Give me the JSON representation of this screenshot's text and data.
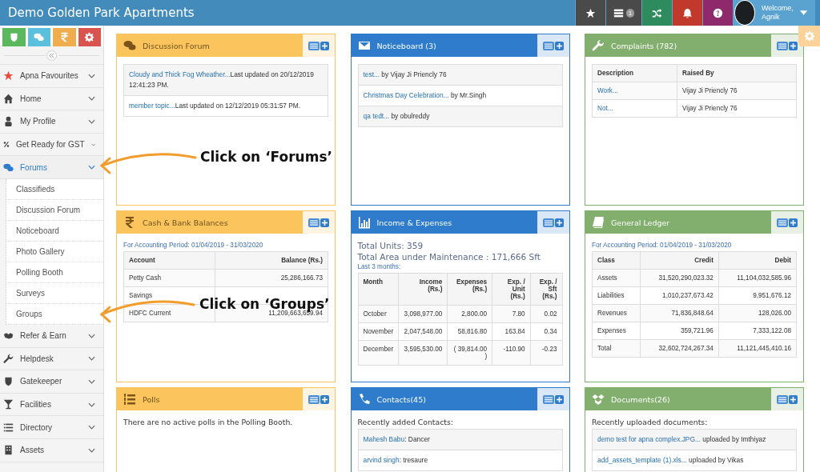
{
  "header": {
    "title": "Demo Golden Park Apartments",
    "buttons": [
      {
        "color": "#4a4a4a"
      },
      {
        "color": "#4a4a4a",
        "badge": "1"
      },
      {
        "color": "#2e8b5e"
      },
      {
        "color": "#c0392b"
      },
      {
        "color": "#8e2a6b"
      }
    ],
    "user": {
      "greeting": "Welcome,",
      "name": "Agnik"
    }
  },
  "sidebar": {
    "shortcuts": [
      {
        "color": "#5cb85c"
      },
      {
        "color": "#5bc0de"
      },
      {
        "color": "#f0ad4e"
      },
      {
        "color": "#d9534f"
      }
    ],
    "items": [
      {
        "label": "Apna Favourites",
        "selected": false
      },
      {
        "label": "Home",
        "selected": false
      },
      {
        "label": "My Profile",
        "selected": false
      },
      {
        "label": "Get Ready for GST",
        "selected": false
      },
      {
        "label": "Forums",
        "selected": true,
        "children": [
          {
            "label": "Classifieds"
          },
          {
            "label": "Discussion Forum"
          },
          {
            "label": "Noticeboard"
          },
          {
            "label": "Photo Gallery"
          },
          {
            "label": "Polling Booth"
          },
          {
            "label": "Surveys"
          },
          {
            "label": "Groups"
          }
        ]
      },
      {
        "label": "Refer & Earn",
        "selected": false
      },
      {
        "label": "Helpdesk",
        "selected": false
      },
      {
        "label": "Gatekeeper",
        "selected": false
      },
      {
        "label": "Facilities",
        "selected": false
      },
      {
        "label": "Directory",
        "selected": false
      },
      {
        "label": "Assets",
        "selected": false
      }
    ]
  },
  "panels": [
    {
      "title": "Discussion Forum",
      "color": "#fcc45c",
      "items": [
        {
          "link": "Cloudy and Thick Fog Wheather...",
          "text": "Last updated on 20/12/2019 12:41:23 PM."
        },
        {
          "link": "member topic...",
          "text": "Last updated on 12/12/2019 05:31:57 PM."
        }
      ]
    },
    {
      "title": "Noticeboard (3)",
      "color": "#2f7ccc",
      "items": [
        {
          "link": "test...",
          "text": " by Vijay Ji Priencly 76"
        },
        {
          "link": "Christmas Day Celebration...",
          "text": " by Mr.Singh"
        },
        {
          "link": "qa tedt...",
          "text": " by obulreddy"
        }
      ]
    },
    {
      "title": "Complaints (782)",
      "color": "#82ae6e",
      "table": {
        "columns": [
          {
            "label": "Description",
            "link": true
          },
          {
            "label": "Raised By"
          }
        ],
        "rows": [
          [
            "Work...",
            "Vijay Ji Priencly 76"
          ],
          [
            "Not...",
            "Vijay Ji Priencly 76"
          ]
        ]
      }
    },
    {
      "title": "Cash & Bank Balances",
      "color": "#fcc45c",
      "notes": [
        {
          "kind": "period",
          "text": "For Accounting Period: 01/04/2019 - 31/03/2020"
        }
      ],
      "table": {
        "columns": [
          {
            "label": "Account"
          },
          {
            "label": "Balance (Rs.)",
            "right": true
          }
        ],
        "rows": [
          [
            "Petty Cash",
            "25,286,166.73"
          ],
          [
            "Savings"
          ],
          [
            "HDFC Current",
            "11,209,663,659.94"
          ]
        ]
      }
    },
    {
      "title": "Income & Expenses",
      "color": "#2f7ccc",
      "notes": [
        {
          "kind": "summary",
          "text": "Total Units: 359"
        },
        {
          "kind": "summary",
          "text": "Total Area under Maintenance : 171,666 Sft"
        },
        {
          "kind": "period",
          "text": "Last 3 months:"
        }
      ],
      "table": {
        "columns": [
          {
            "label": "Month"
          },
          {
            "label": "Income (Rs.)",
            "right": true
          },
          {
            "label": "Expenses (Rs.)",
            "right": true
          },
          {
            "label": "Exp. / Unit (Rs.)",
            "right": true
          },
          {
            "label": "Exp. / Sft (Rs.)",
            "right": true
          }
        ],
        "rows": [
          [
            "October",
            "3,098,977.00",
            "2,800.00",
            "7.80",
            "0.02"
          ],
          [
            "November",
            "2,047,548.00",
            "58,816.80",
            "163.84",
            "0.34"
          ],
          [
            "December",
            "3,595,530.00",
            "( 39,814.00 )",
            "-110.90",
            "-0.23"
          ]
        ]
      }
    },
    {
      "title": "General Ledger",
      "color": "#82ae6e",
      "notes": [
        {
          "kind": "period",
          "text": "For Accounting Period: 01/04/2019 - 31/03/2020"
        }
      ],
      "table": {
        "columns": [
          {
            "label": "Class"
          },
          {
            "label": "Credit",
            "right": true
          },
          {
            "label": "Debit",
            "right": true
          }
        ],
        "rows": [
          [
            "Assets",
            "31,520,290,023.32",
            "11,104,032,585.96"
          ],
          [
            "Liabilities",
            "1,010,237,673.42",
            "9,951,676.12"
          ],
          [
            "Revenues",
            "71,836,848.64",
            "128,026.00"
          ],
          [
            "Expenses",
            "359,721.96",
            "7,333,122.08"
          ],
          [
            "Total",
            "32,602,724,267.34",
            "11,121,445,410.16"
          ]
        ]
      }
    },
    {
      "title": "Polls",
      "color": "#fcc45c",
      "notes": [
        {
          "kind": "plain",
          "text": "There are no active polls in the Polling Booth."
        }
      ]
    },
    {
      "title": "Contacts(45)",
      "color": "#2f7ccc",
      "notes": [
        {
          "kind": "plain",
          "text": "Recently added Contacts:"
        }
      ],
      "items": [
        {
          "link": "Mahesh Babu",
          "text": ": Dancer"
        },
        {
          "link": "arvind singh",
          "text": ": tresaure"
        }
      ]
    },
    {
      "title": "Documents(26)",
      "color": "#82ae6e",
      "notes": [
        {
          "kind": "plain",
          "text": "Recently uploaded documents:"
        }
      ],
      "items": [
        {
          "link": "demo test for apna complex.JPG...",
          "text": " uploaded by Imthiyaz"
        },
        {
          "link": "add_assets_template (1).xls...",
          "text": " uploaded by Vikas"
        }
      ]
    }
  ],
  "annotations": [
    {
      "text": "Click on ‘Forums’"
    },
    {
      "text": "Click on ‘Groups’"
    }
  ]
}
